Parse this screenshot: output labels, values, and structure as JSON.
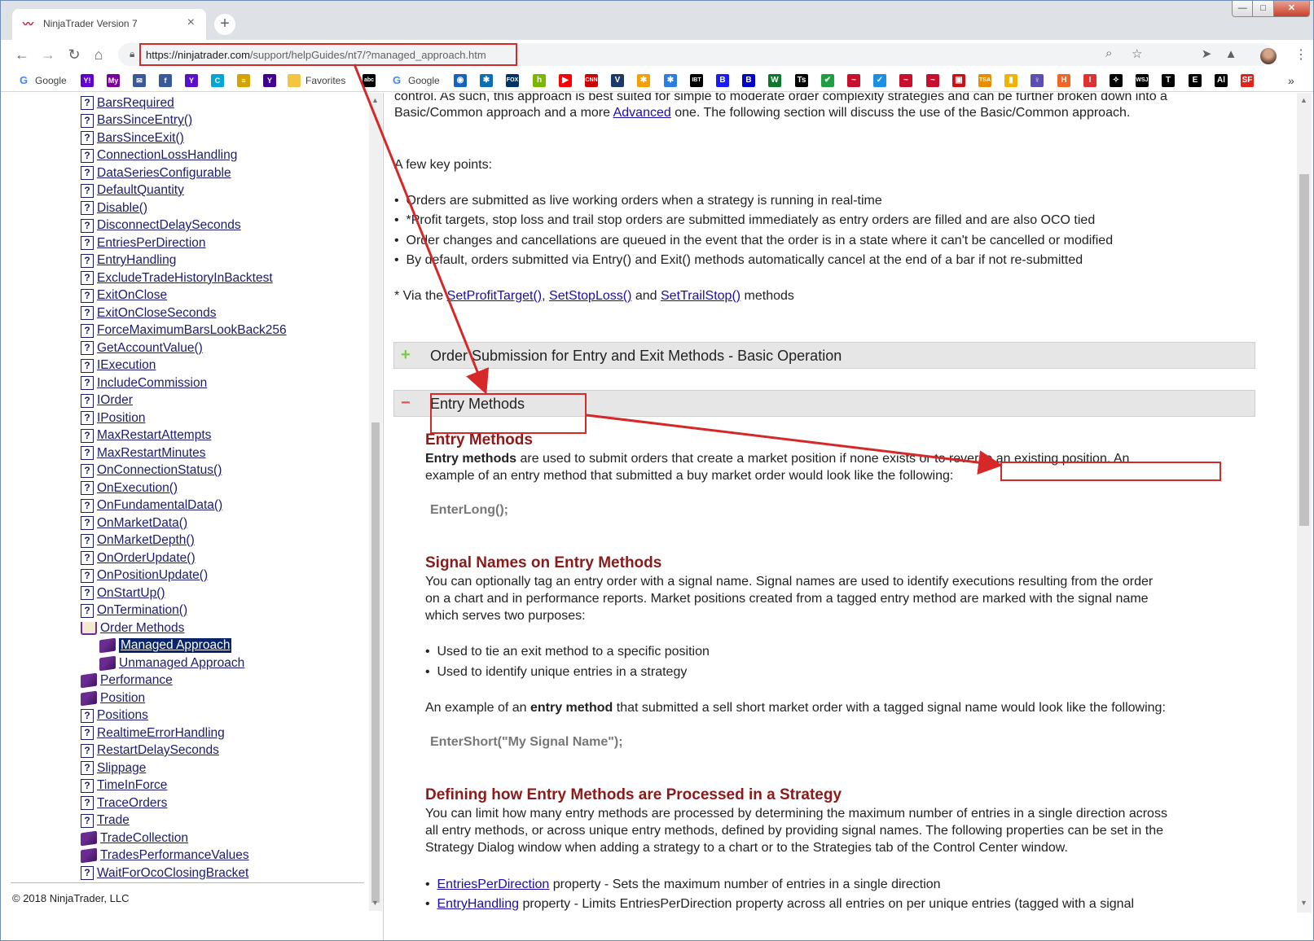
{
  "browser": {
    "tab_title": "NinjaTrader Version 7",
    "url_host": "https://ninjatrader.com",
    "url_path": "/support/helpGuides/nt7/?managed_approach.htm",
    "new_tab": "+",
    "win_minimize": "—",
    "win_maximize": "□",
    "win_close": "✕"
  },
  "bookmarks": {
    "google1": "Google",
    "favorites": "Favorites",
    "google2": "Google",
    "more": "»",
    "icons": [
      {
        "label": "Y!",
        "color": "#6001d2"
      },
      {
        "label": "My",
        "color": "#7b0099"
      },
      {
        "label": "✉",
        "color": "#3b5998"
      },
      {
        "label": "f",
        "color": "#3b5998"
      },
      {
        "label": "Y",
        "color": "#5a0fc8"
      },
      {
        "label": "C",
        "color": "#00a6d6"
      },
      {
        "label": "≡",
        "color": "#d4a300"
      },
      {
        "label": "Y",
        "color": "#410093"
      }
    ],
    "right_icons": [
      {
        "label": "abc",
        "color": "#000000"
      },
      {
        "label": "G",
        "color": "#4285f4"
      },
      {
        "label": "◉",
        "color": "#1565c0"
      },
      {
        "label": "✱",
        "color": "#0b6fb5"
      },
      {
        "label": "FOX",
        "color": "#003366"
      },
      {
        "label": "h",
        "color": "#7ab800"
      },
      {
        "label": "▶",
        "color": "#ff0000"
      },
      {
        "label": "CNN",
        "color": "#cc0000"
      },
      {
        "label": "V",
        "color": "#1a3a6b"
      },
      {
        "label": "✱",
        "color": "#f5a000"
      },
      {
        "label": "✱",
        "color": "#2a7de1"
      },
      {
        "label": "IBT",
        "color": "#000000"
      },
      {
        "label": "B",
        "color": "#1a1aff"
      },
      {
        "label": "B",
        "color": "#0000cc"
      },
      {
        "label": "W",
        "color": "#0a7a2a"
      },
      {
        "label": "Ts",
        "color": "#000000"
      },
      {
        "label": "✔",
        "color": "#1e9e3e"
      },
      {
        "label": "~",
        "color": "#c8102e"
      },
      {
        "label": "✓",
        "color": "#1a8fe3"
      },
      {
        "label": "~",
        "color": "#c8102e"
      },
      {
        "label": "~",
        "color": "#c8102e"
      },
      {
        "label": "▣",
        "color": "#d01010"
      },
      {
        "label": "TSA",
        "color": "#e88c00"
      },
      {
        "label": "▮",
        "color": "#f2b300"
      },
      {
        "label": "♀",
        "color": "#5b4fb0"
      },
      {
        "label": "H",
        "color": "#f26522"
      },
      {
        "label": "I",
        "color": "#e03030"
      },
      {
        "label": "✧",
        "color": "#000000"
      },
      {
        "label": "WSJ",
        "color": "#000000"
      },
      {
        "label": "T",
        "color": "#000000"
      },
      {
        "label": "E",
        "color": "#000000"
      },
      {
        "label": "Al",
        "color": "#000000"
      },
      {
        "label": "SF",
        "color": "#e2231a"
      }
    ]
  },
  "sidebar": {
    "items": [
      {
        "label": "BarsRequired",
        "icon": "q"
      },
      {
        "label": "BarsSinceEntry()",
        "icon": "q"
      },
      {
        "label": "BarsSinceExit()",
        "icon": "q"
      },
      {
        "label": "ConnectionLossHandling",
        "icon": "q"
      },
      {
        "label": "DataSeriesConfigurable",
        "icon": "q"
      },
      {
        "label": "DefaultQuantity",
        "icon": "q"
      },
      {
        "label": "Disable()",
        "icon": "q"
      },
      {
        "label": "DisconnectDelaySeconds",
        "icon": "q"
      },
      {
        "label": "EntriesPerDirection",
        "icon": "q"
      },
      {
        "label": "EntryHandling",
        "icon": "q"
      },
      {
        "label": "ExcludeTradeHistoryInBacktest",
        "icon": "q"
      },
      {
        "label": "ExitOnClose",
        "icon": "q"
      },
      {
        "label": "ExitOnCloseSeconds",
        "icon": "q"
      },
      {
        "label": "ForceMaximumBarsLookBack256",
        "icon": "q"
      },
      {
        "label": "GetAccountValue()",
        "icon": "q"
      },
      {
        "label": "IExecution",
        "icon": "q"
      },
      {
        "label": "IncludeCommission",
        "icon": "q"
      },
      {
        "label": "IOrder",
        "icon": "q"
      },
      {
        "label": "IPosition",
        "icon": "q"
      },
      {
        "label": "MaxRestartAttempts",
        "icon": "q"
      },
      {
        "label": "MaxRestartMinutes",
        "icon": "q"
      },
      {
        "label": "OnConnectionStatus()",
        "icon": "q"
      },
      {
        "label": "OnExecution()",
        "icon": "q"
      },
      {
        "label": "OnFundamentalData()",
        "icon": "q"
      },
      {
        "label": "OnMarketData()",
        "icon": "q"
      },
      {
        "label": "OnMarketDepth()",
        "icon": "q"
      },
      {
        "label": "OnOrderUpdate()",
        "icon": "q"
      },
      {
        "label": "OnPositionUpdate()",
        "icon": "q"
      },
      {
        "label": "OnStartUp()",
        "icon": "q"
      },
      {
        "label": "OnTermination()",
        "icon": "q"
      },
      {
        "label": "Order Methods",
        "icon": "openbook"
      },
      {
        "label": "Managed Approach",
        "icon": "book",
        "sub": true,
        "selected": true
      },
      {
        "label": "Unmanaged Approach",
        "icon": "book",
        "sub": true
      },
      {
        "label": "Performance",
        "icon": "book"
      },
      {
        "label": "Position",
        "icon": "book"
      },
      {
        "label": "Positions",
        "icon": "q"
      },
      {
        "label": "RealtimeErrorHandling",
        "icon": "q"
      },
      {
        "label": "RestartDelaySeconds",
        "icon": "q"
      },
      {
        "label": "Slippage",
        "icon": "q"
      },
      {
        "label": "TimeInForce",
        "icon": "q"
      },
      {
        "label": "TraceOrders",
        "icon": "q"
      },
      {
        "label": "Trade",
        "icon": "q"
      },
      {
        "label": "TradeCollection",
        "icon": "book"
      },
      {
        "label": "TradesPerformanceValues",
        "icon": "book"
      },
      {
        "label": "WaitForOcoClosingBracket",
        "icon": "q"
      }
    ],
    "copyright": "© 2018 NinjaTrader, LLC"
  },
  "content": {
    "intro_line1": "control. As such, this approach is best suited for simple to moderate order complexity strategies and can be further broken down into a",
    "intro_line2_pre": "Basic/Common approach and a more ",
    "intro_line2_link": "Advanced",
    "intro_line2_post": " one. The following section will discuss the use of the Basic/Common approach.",
    "key_points_heading": "A few key points:",
    "key_points": [
      "Orders are submitted as live working orders when a strategy is running in real-time",
      "*Profit targets, stop loss and trail stop orders are submitted immediately as entry orders are filled and are also OCO tied",
      "Order changes and cancellations are queued in the event that the order is in a state where it can't be cancelled or modified",
      "By default, orders submitted via Entry() and Exit() methods automatically cancel at the end of a bar if not re-submitted"
    ],
    "via_pre": "* Via the ",
    "via_link1": "SetProfitTarget()",
    "via_comma": ", ",
    "via_link2": "SetStopLoss()",
    "via_and": " and ",
    "via_link3": "SetTrailStop()",
    "via_post": " methods",
    "section_basic": "Order Submission for Entry and Exit Methods - Basic Operation",
    "section_basic_sign": "+",
    "section_entry": "Entry Methods",
    "section_entry_sign": "−",
    "entry_heading": "Entry Methods",
    "entry_p1_bold": "Entry methods",
    "entry_p1_mid": " are used to submit orders that create a market position if none exists",
    "entry_p1_boxed": " or to reverse an existing position.",
    "entry_p1_end": " An",
    "entry_p2": "example of an entry method that submitted a buy market order would look like the following:",
    "code1": "EnterLong();",
    "signal_heading": "Signal Names on Entry Methods",
    "signal_p1": "You can optionally tag an entry order with a signal name. Signal names are used to identify executions resulting from the order",
    "signal_p2": "on a chart and in performance reports. Market positions created from a tagged entry method are marked with the signal name",
    "signal_p3": "which serves two purposes:",
    "signal_bullets": [
      "Used to tie an exit method to a specific position",
      "Used to identify unique entries in a strategy"
    ],
    "example_pre": "An example of an ",
    "example_bold": "entry method",
    "example_post": " that submitted a sell short market order with a tagged signal name would look like the following:",
    "code2": "EnterShort(\"My Signal Name\");",
    "defining_heading": "Defining how Entry Methods are Processed in a Strategy",
    "defining_p1": "You can limit how many entry methods are processed by determining the maximum number of entries in a single direction across",
    "defining_p2": "all entry methods, or across unique entry methods, defined by providing signal names. The following properties can be set in the",
    "defining_p3": "Strategy Dialog window when adding a strategy to a chart or to the Strategies tab of the Control Center window.",
    "prop1_link": "EntriesPerDirection",
    "prop1_text": " property - Sets the maximum number of entries in a single direction",
    "prop2_link": "EntryHandling",
    "prop2_text": " property - Limits EntriesPerDirection property across all entries on per unique entries (tagged with a signal"
  },
  "colors": {
    "annotation_red": "#d62828",
    "heading_red": "#8b1a1a",
    "link_blue": "#1a0dab",
    "tree_blue": "#1c1c6c",
    "selection": "#0a246a"
  }
}
